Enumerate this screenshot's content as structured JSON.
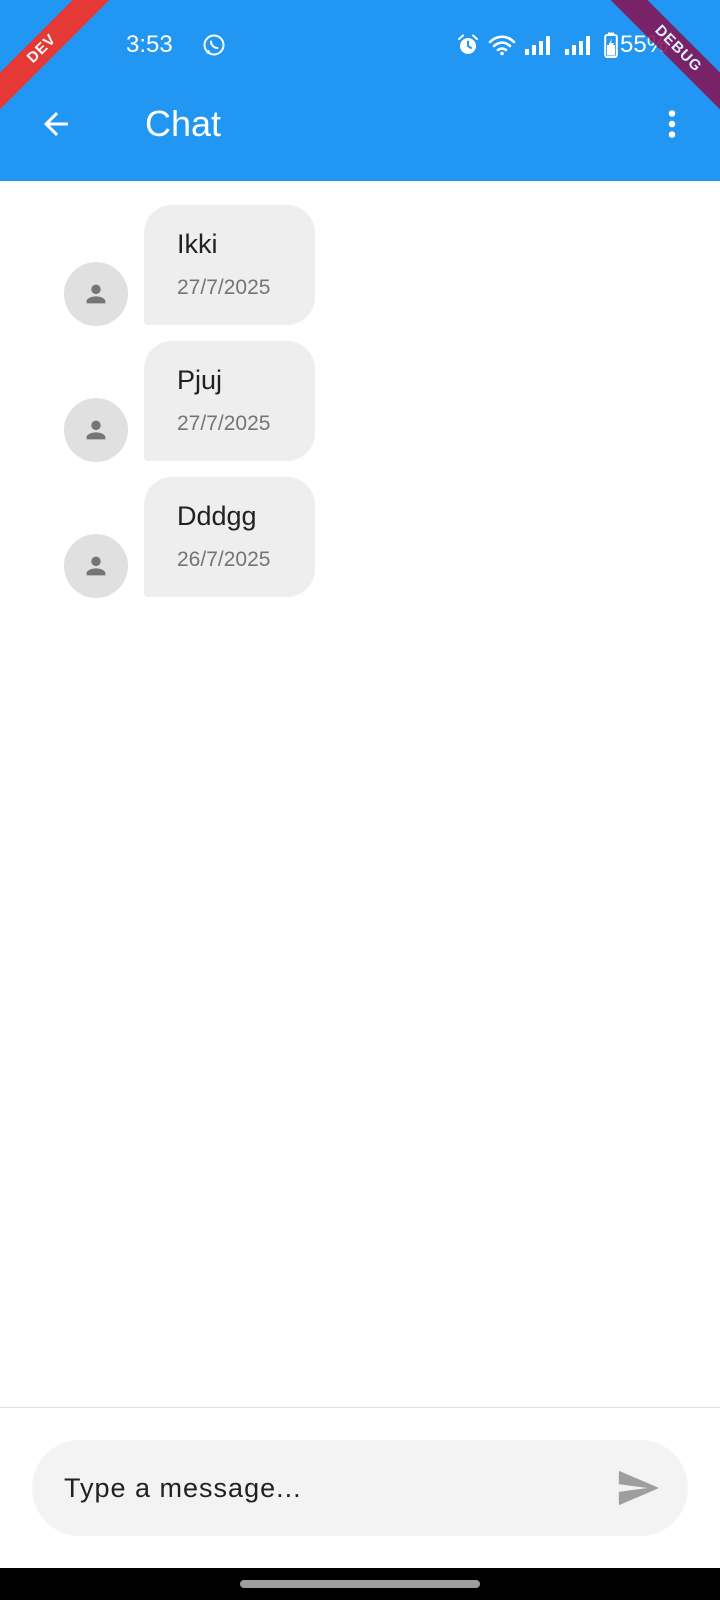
{
  "status_bar": {
    "time": "3:53",
    "battery": "55%"
  },
  "banners": {
    "left": "DEV",
    "right": "DEBUG"
  },
  "appbar": {
    "title": "Chat"
  },
  "messages": [
    {
      "text": "Ikki",
      "date": "27/7/2025"
    },
    {
      "text": "Pjuj",
      "date": "27/7/2025"
    },
    {
      "text": "Dddgg",
      "date": "26/7/2025"
    }
  ],
  "composer": {
    "placeholder": "Type a message..."
  },
  "colors": {
    "primary": "#2196F3",
    "bubble": "#EEEEEE",
    "avatar": "#E0E0E0",
    "dev_banner": "#E53935",
    "debug_banner": "#880E4F"
  }
}
